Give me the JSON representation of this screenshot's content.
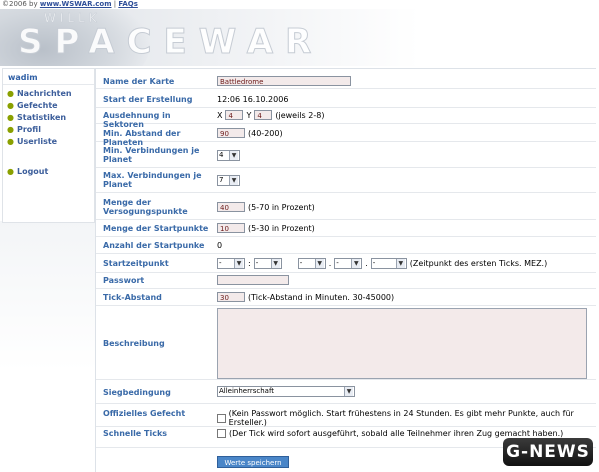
{
  "topbar": {
    "copyright": "©2006 by",
    "site_link": "www.WSWAR.com",
    "sep": "|",
    "faq_link": "FAQs"
  },
  "banner": {
    "logo_text": "SPACEWAR",
    "sub_text": "WILLK"
  },
  "sidebar": {
    "username": "wadim",
    "items": [
      {
        "label": "Nachrichten"
      },
      {
        "label": "Gefechte"
      },
      {
        "label": "Statistiken"
      },
      {
        "label": "Profil"
      },
      {
        "label": "Userliste"
      }
    ],
    "logout": "Logout"
  },
  "form": {
    "map_name": {
      "label": "Name der Karte",
      "value": "Battledrome"
    },
    "created": {
      "label": "Start der Erstellung",
      "value": "12:06 16.10.2006"
    },
    "sectors": {
      "label": "Ausdehnung in Sektoren",
      "x_label": "X",
      "x_value": "4",
      "y_label": "Y",
      "y_value": "4",
      "hint": "(jeweils 2-8)"
    },
    "planet_distance": {
      "label": "Min. Abstand der Planeten",
      "value": "90",
      "hint": "(40-200)"
    },
    "min_connections": {
      "label": "Min. Verbindungen je Planet",
      "value": "4"
    },
    "max_connections": {
      "label": "Max. Verbindungen je Planet",
      "value": "7"
    },
    "supply_points": {
      "label": "Menge der Versogungspunkte",
      "value": "40",
      "hint": "(5-70 in Prozent)"
    },
    "start_points": {
      "label": "Menge der Startpunkte",
      "value": "10",
      "hint": "(5-30 in Prozent)"
    },
    "start_count": {
      "label": "Anzahl der Startpunke",
      "value": "0"
    },
    "start_time": {
      "label": "Startzeitpunkt",
      "parts": [
        "-",
        "-",
        "-",
        "-",
        "-"
      ],
      "seps": [
        ":",
        ".",
        ".",
        ""
      ],
      "hint": "(Zeitpunkt des ersten Ticks. MEZ.)"
    },
    "password": {
      "label": "Passwort",
      "value": ""
    },
    "tick": {
      "label": "Tick-Abstand",
      "value": "30",
      "hint": "(Tick-Abstand in Minuten. 30-45000)"
    },
    "description": {
      "label": "Beschreibung"
    },
    "victory": {
      "label": "Siegbedingung",
      "value": "Alleinherrschaft"
    },
    "official": {
      "label": "Offizielles Gefecht",
      "hint": "(Kein Passwort möglich. Start frühestens in 24 Stunden. Es gibt mehr Punkte, auch für Ersteller.)"
    },
    "fast_ticks": {
      "label": "Schnelle Ticks",
      "hint": "(Der Tick wird sofort ausgeführt, sobald alle Teilnehmer ihren Zug gemacht haben.)"
    },
    "save_label": "Werte speichern"
  },
  "watermark": "G-NEWS"
}
